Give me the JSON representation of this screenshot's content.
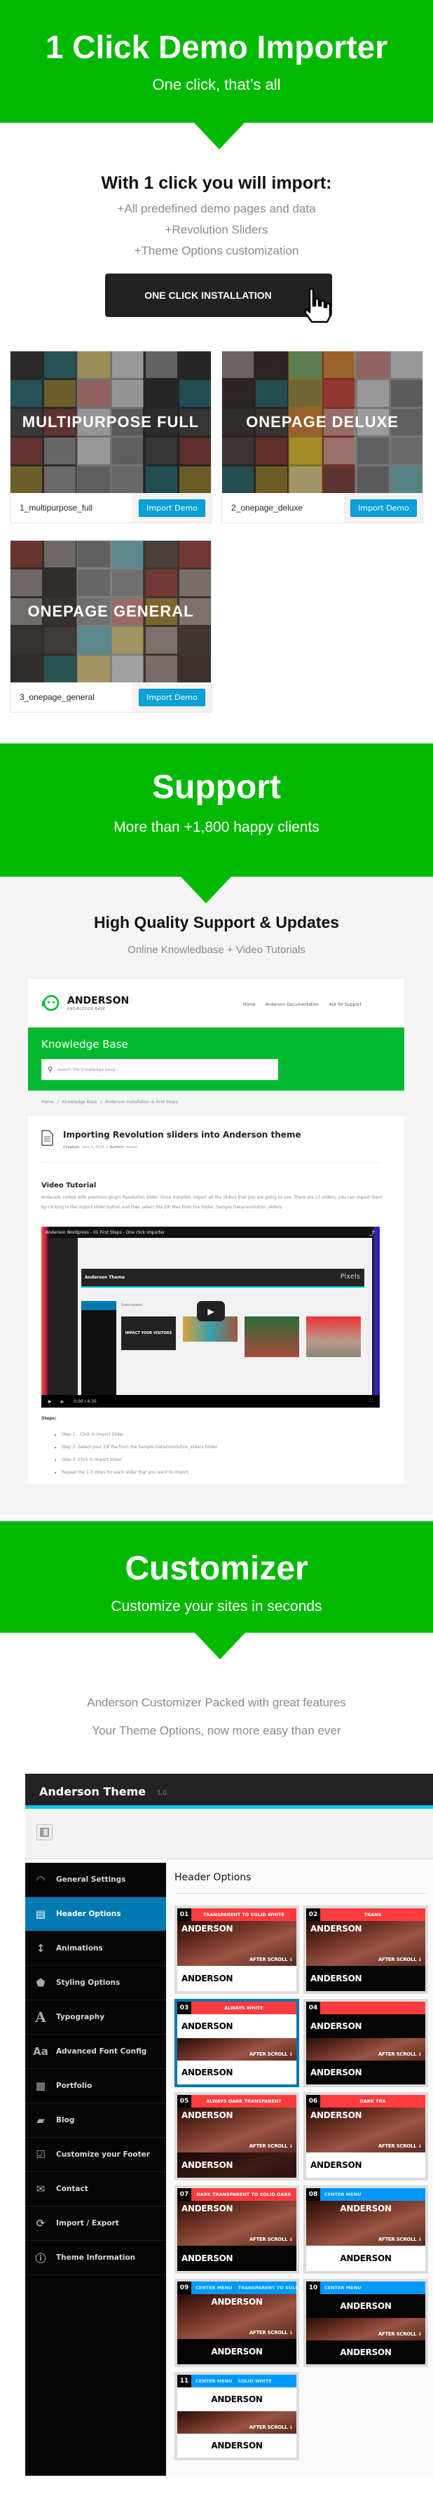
{
  "colors": {
    "green": "#00b900",
    "dark_button": "#222222",
    "import_blue": "#0aa0d8",
    "sidebar_active": "#0079b0",
    "label_red": "#ff3b3f",
    "label_blue": "#0099ff",
    "cyan": "#00c8f0"
  },
  "importer": {
    "title": "1 Click Demo Importer",
    "subtitle": "One click, that’s all",
    "heading": "With 1 click you will import:",
    "bullets": [
      "+All predefined demo pages and data",
      "+Revolution Sliders",
      "+Theme Options customization"
    ],
    "button": "ONE CLICK INSTALLATION",
    "cursor_icon": "hand-pointer-icon",
    "demos": [
      {
        "overlay": "MULTIPURPOSE FULL",
        "name": "1_multipurpose_full",
        "button": "Import Demo"
      },
      {
        "overlay": "ONEPAGE DELUXE",
        "name": "2_onepage_deluxe",
        "button": "Import Demo"
      },
      {
        "overlay": "ONEPAGE GENERAL",
        "name": "3_onepage_general",
        "button": "Import Demo"
      }
    ]
  },
  "support": {
    "title": "Support",
    "subtitle": "More than +1,800 happy clients",
    "heading": "High Quality Support & Updates",
    "tagline": "Online Knowledbase + Video Tutorials",
    "kb": {
      "logo": "ANDERSON",
      "logo_sub": "KNOWLEDGE BASE",
      "nav": [
        "Home",
        "Anderson Documentation",
        "Ask for Support"
      ],
      "band_title": "Knowledge Base",
      "search_placeholder": "Search the knowledge base...",
      "breadcrumb": [
        "Home",
        "Knowledge Base",
        "Anderson Installation & First Steps"
      ],
      "article_title": "Importing Revolution sliders into Anderson theme",
      "meta_created_label": "Created:",
      "meta_created": "June 5, 2015",
      "meta_author_label": "Author:",
      "meta_author": "admin",
      "section": "Video Tutorial",
      "paragraph": "Anderson comes with premium plugin Revolution Slider. Once installed, import all the sliders that you are going to use. There are 15 sliders, you can import them by clicking in the import slider button and then select the ZIP files from the folder, Sample Data/revolution_sliders",
      "video": {
        "title": "Anderson Wordpress - 01 First Steps - One click importer",
        "inner_title": "Anderson Theme",
        "brand": "Pixels",
        "section": "Demo Importer",
        "slide_text": "IMPACT YOUR VISITORS",
        "time": "0:00 / 4:35"
      },
      "steps_label": "Steps:",
      "steps": [
        "Step 1  – Click in Import Slider",
        "Step 2  -Select your ZIP file from the Sample Data/revolution_sliders folder",
        "Step 3  -Click in Import Slider",
        "Repeat the 1-3 steps for each slider that you want to import."
      ]
    }
  },
  "customizer": {
    "title": "Customizer",
    "subtitle": "Customize your sites in seconds",
    "lines": [
      "Anderson Customizer Packed with great features",
      "Your Theme Options, now more easy than ever"
    ],
    "panel": {
      "title": "Anderson Theme",
      "version": "1.0",
      "content_title": "Header Options",
      "sidebar": [
        {
          "label": "General Settings",
          "icon": "dashboard-icon"
        },
        {
          "label": "Header Options",
          "icon": "header-layout-icon",
          "active": true
        },
        {
          "label": "Animations",
          "icon": "vertical-arrows-icon"
        },
        {
          "label": "Styling Options",
          "icon": "css-icon"
        },
        {
          "label": "Typography",
          "icon": "typography-icon"
        },
        {
          "label": "Advanced Font Config",
          "icon": "font-icon"
        },
        {
          "label": "Portfolio",
          "icon": "grid-icon"
        },
        {
          "label": "Blog",
          "icon": "comment-icon"
        },
        {
          "label": "Customize your Footer",
          "icon": "checkbox-icon"
        },
        {
          "label": "Contact",
          "icon": "envelope-icon"
        },
        {
          "label": "Import / Export",
          "icon": "refresh-icon"
        },
        {
          "label": "Theme Information",
          "icon": "info-icon"
        }
      ],
      "logo_text": "ANDERSON",
      "after_scroll": "AFTER SCROLL",
      "cards": [
        {
          "num": "01",
          "color": "red",
          "labels": [
            "TRANSPARENT TO SOLID WHITE"
          ],
          "sections": [
            "img-tall",
            "white"
          ]
        },
        {
          "num": "02",
          "color": "red",
          "labels": [
            "TRANS"
          ],
          "sections": [
            "img-tall",
            "dark"
          ]
        },
        {
          "num": "03",
          "color": "red",
          "labels": [
            "ALWAYS WHITE"
          ],
          "sections": [
            "white",
            "img-strip",
            "white"
          ],
          "selected": true
        },
        {
          "num": "04",
          "color": "red",
          "labels": [
            ""
          ],
          "sections": [
            "dark",
            "img-strip",
            "dark"
          ]
        },
        {
          "num": "05",
          "color": "red",
          "labels": [
            "ALWAYS DARK TRANSPARENT"
          ],
          "sections": [
            "img-tall",
            "dimimg"
          ]
        },
        {
          "num": "06",
          "color": "red",
          "labels": [
            "DARK TRA"
          ],
          "sections": [
            "img-tall",
            "white"
          ]
        },
        {
          "num": "07",
          "color": "red",
          "labels": [
            "DARK TRANSPARENT TO SOLID DARK"
          ],
          "sections": [
            "img-tall",
            "dark"
          ]
        },
        {
          "num": "08",
          "color": "blue",
          "labels": [
            "CENTER MENU"
          ],
          "centered": true,
          "sections": [
            "img-tall",
            "white"
          ]
        },
        {
          "num": "09",
          "color": "blue",
          "labels": [
            "CENTER MENU",
            "TRANSPARENT TO SOLID DARK"
          ],
          "centered": true,
          "sections": [
            "img-tall",
            "dark"
          ]
        },
        {
          "num": "10",
          "color": "blue",
          "labels": [
            "CENTER MENU"
          ],
          "centered": true,
          "sections": [
            "dark",
            "img-strip",
            "dark"
          ]
        },
        {
          "num": "11",
          "color": "blue",
          "labels": [
            "CENTER MENU",
            "SOLID WHITE"
          ],
          "centered": true,
          "sections": [
            "white",
            "img-strip",
            "white"
          ]
        }
      ]
    }
  }
}
